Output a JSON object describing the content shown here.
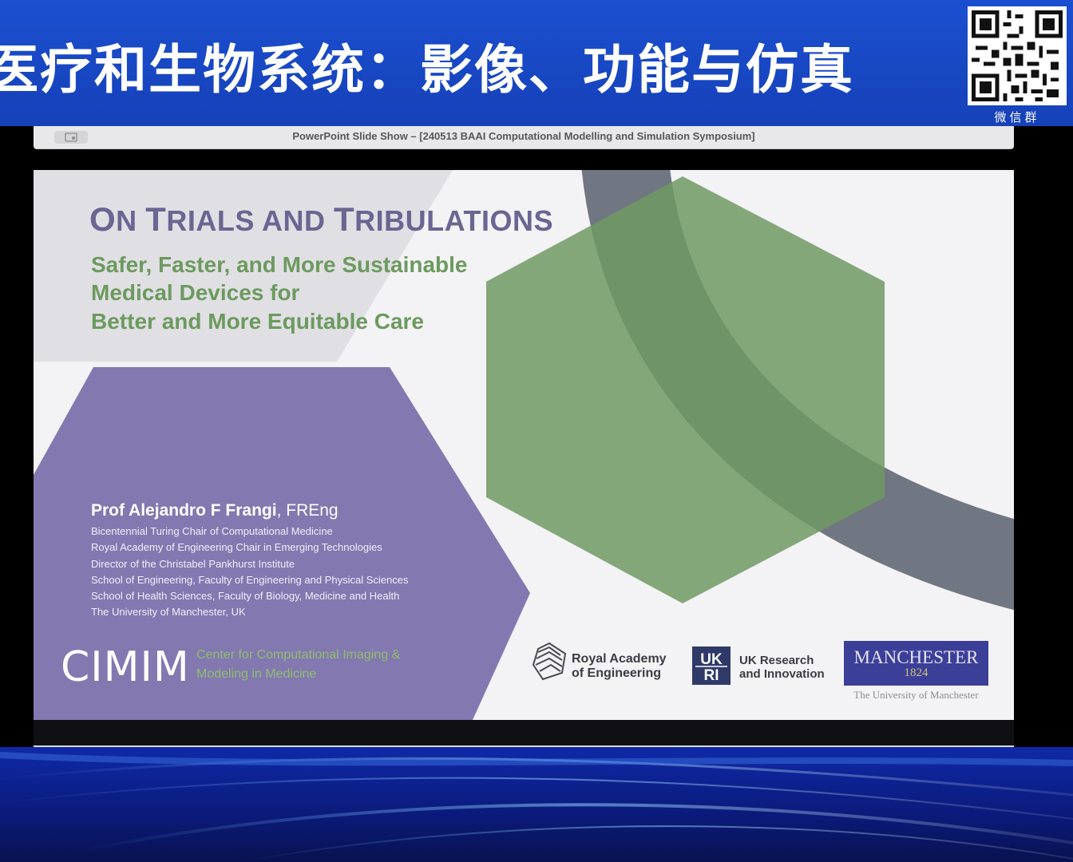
{
  "banner": {
    "title": "医疗和生物系统：影像、功能与仿真",
    "qr_caption": "微信群"
  },
  "window": {
    "title": "PowerPoint Slide Show – [240513 BAAI Computational Modelling and Simulation Symposium]"
  },
  "slide": {
    "title_big_on": "O",
    "title_rest_on": "N ",
    "title_big_t": "T",
    "title_rest_1": "RIALS AND ",
    "title_big_tr": "T",
    "title_rest_2": "RIBULATIONS",
    "subtitle_lines": [
      "Safer, Faster, and More Sustainable",
      "Medical Devices for",
      "Better and More Equitable Care"
    ],
    "presenter_name": "Prof Alejandro F Frangi",
    "presenter_suffix": ", FREng",
    "affiliations": [
      "Bicentennial Turing Chair of Computational Medicine",
      "Royal Academy of Engineering Chair in Emerging Technologies",
      "Director of the Christabel Pankhurst Institute",
      "School of Engineering, Faculty of Engineering and Physical Sciences",
      "School of Health Sciences, Faculty of Biology, Medicine and Health",
      "The University of Manchester, UK"
    ],
    "cimim": "CIMIM",
    "cimim_desc": [
      "Center for Computational Imaging &",
      "Modeling in Medicine"
    ],
    "rae": [
      "Royal Academy",
      "of Engineering"
    ],
    "ukri": [
      "UK Research",
      "and Innovation"
    ],
    "manchester": {
      "name": "MANCHESTER",
      "year": "1824",
      "sub": "The University of Manchester"
    }
  },
  "colors": {
    "banner_blue": "#1b4fd0",
    "slide_purple": "#8378b0",
    "hex_green": "#6f9a63",
    "title_purple": "#6a6591",
    "subtitle_green": "#6c9a5e"
  }
}
